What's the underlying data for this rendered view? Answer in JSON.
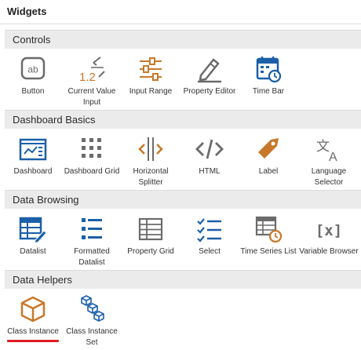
{
  "panel": {
    "title": "Widgets"
  },
  "colors": {
    "blue": "#1b5fa8",
    "orange": "#c8782a",
    "gray": "#6b6b6b",
    "selected": "#e01b24"
  },
  "sections": [
    {
      "title": "Controls",
      "widgets": [
        {
          "label": "Button",
          "icon": "button-icon"
        },
        {
          "label": "Current Value Input",
          "icon": "current-value-input-icon"
        },
        {
          "label": "Input Range",
          "icon": "input-range-icon"
        },
        {
          "label": "Property Editor",
          "icon": "property-editor-icon"
        },
        {
          "label": "Time Bar",
          "icon": "time-bar-icon"
        }
      ]
    },
    {
      "title": "Dashboard Basics",
      "widgets": [
        {
          "label": "Dashboard",
          "icon": "dashboard-icon"
        },
        {
          "label": "Dashboard Grid",
          "icon": "dashboard-grid-icon"
        },
        {
          "label": "Horizontal Splitter",
          "icon": "horizontal-splitter-icon"
        },
        {
          "label": "HTML",
          "icon": "html-icon"
        },
        {
          "label": "Label",
          "icon": "label-tag-icon"
        },
        {
          "label": "Language Selector",
          "icon": "language-selector-icon"
        }
      ]
    },
    {
      "title": "Data Browsing",
      "widgets": [
        {
          "label": "Datalist",
          "icon": "datalist-icon"
        },
        {
          "label": "Formatted Datalist",
          "icon": "formatted-datalist-icon"
        },
        {
          "label": "Property Grid",
          "icon": "property-grid-icon"
        },
        {
          "label": "Select",
          "icon": "select-icon"
        },
        {
          "label": "Time Series List",
          "icon": "time-series-list-icon"
        },
        {
          "label": "Variable Browser",
          "icon": "variable-browser-icon"
        }
      ]
    },
    {
      "title": "Data Helpers",
      "widgets": [
        {
          "label": "Class Instance",
          "icon": "class-instance-icon",
          "selected": true
        },
        {
          "label": "Class Instance Set",
          "icon": "class-instance-set-icon"
        }
      ]
    }
  ]
}
